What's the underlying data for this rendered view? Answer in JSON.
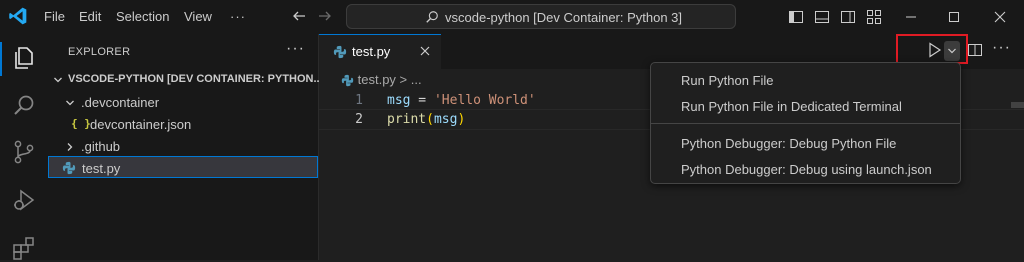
{
  "menu_bar": {
    "items": [
      "File",
      "Edit",
      "Selection",
      "View"
    ],
    "overflow": "···"
  },
  "command_center": {
    "text": "vscode-python [Dev Container: Python 3]"
  },
  "sidebar": {
    "title": "EXPLORER",
    "more": "···",
    "tree": {
      "root": "VSCODE-PYTHON [DEV CONTAINER: PYTHON...",
      "devcontainer_folder": ".devcontainer",
      "devcontainer_json": "devcontainer.json",
      "json_icon_glyph": "{ }",
      "github_folder": ".github",
      "test_file": "test.py"
    }
  },
  "editor": {
    "tab_label": "test.py",
    "more": "···",
    "breadcrumb": {
      "file": "test.py",
      "separator": ">",
      "rest": "..."
    },
    "lines": [
      {
        "number": "1",
        "tokens": [
          "msg",
          " = ",
          "'Hello World'"
        ]
      },
      {
        "number": "2",
        "tokens": [
          "print",
          "(",
          "msg",
          ")"
        ]
      }
    ]
  },
  "run_menu": {
    "items": [
      "Run Python File",
      "Run Python File in Dedicated Terminal",
      "Python Debugger: Debug Python File",
      "Python Debugger: Debug using launch.json"
    ]
  },
  "colors": {
    "accent": "#0078d4",
    "highlight_box": "#e01b24",
    "string": "#ce9178",
    "variable": "#9cdcfe",
    "function": "#dcdcaa"
  },
  "icons": {
    "activity_bar": [
      "explorer-icon",
      "search-icon",
      "source-control-icon",
      "run-debug-icon",
      "extensions-icon"
    ],
    "title_bar": [
      "vscode-logo-icon",
      "back-arrow-icon",
      "forward-arrow-icon",
      "toggle-primary-sidebar-icon",
      "toggle-panel-icon",
      "toggle-secondary-sidebar-icon",
      "customize-layout-icon",
      "minimize-icon",
      "maximize-icon",
      "close-window-icon"
    ],
    "editor": [
      "python-file-icon",
      "close-tab-icon",
      "run-python-file-icon",
      "run-dropdown-chevron-icon",
      "split-editor-icon"
    ]
  }
}
